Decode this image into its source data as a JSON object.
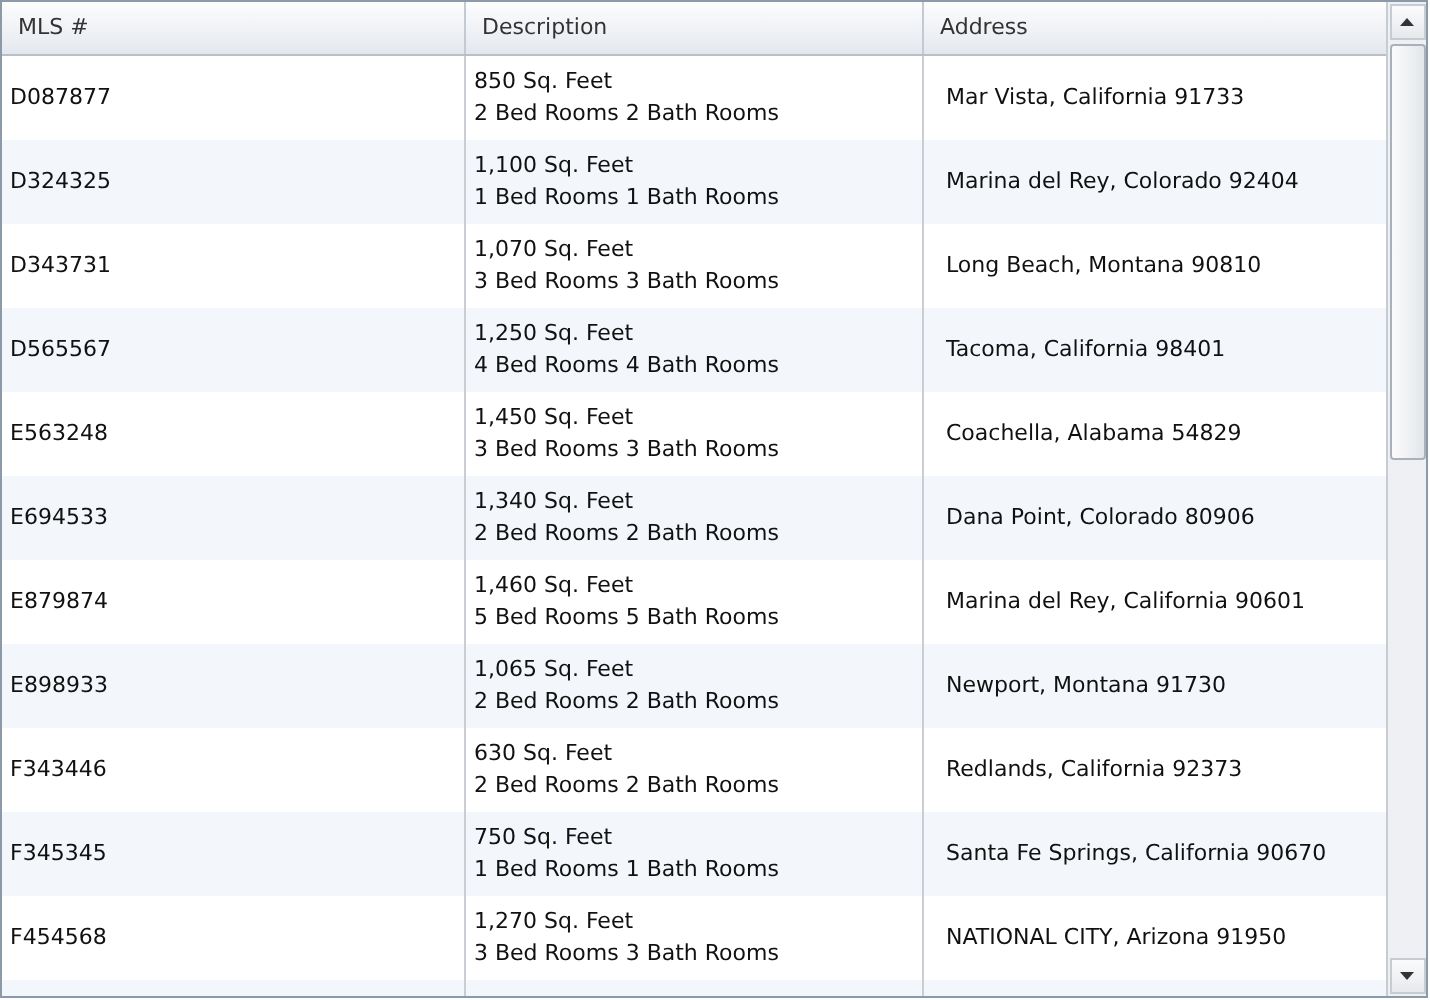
{
  "table": {
    "columns": [
      "MLS #",
      "Description",
      "Address"
    ],
    "rows": [
      {
        "mls": "D087877",
        "area": "850 Sq. Feet",
        "rooms": "2 Bed Rooms 2 Bath Rooms",
        "address": "Mar Vista, California 91733"
      },
      {
        "mls": "D324325",
        "area": "1,100 Sq. Feet",
        "rooms": "1 Bed Rooms 1 Bath Rooms",
        "address": "Marina del Rey, Colorado 92404"
      },
      {
        "mls": "D343731",
        "area": "1,070 Sq. Feet",
        "rooms": "3 Bed Rooms 3 Bath Rooms",
        "address": "Long Beach, Montana 90810"
      },
      {
        "mls": "D565567",
        "area": "1,250 Sq. Feet",
        "rooms": "4 Bed Rooms 4 Bath Rooms",
        "address": "Tacoma, California 98401"
      },
      {
        "mls": "E563248",
        "area": "1,450 Sq. Feet",
        "rooms": "3 Bed Rooms 3 Bath Rooms",
        "address": "Coachella, Alabama 54829"
      },
      {
        "mls": "E694533",
        "area": "1,340 Sq. Feet",
        "rooms": "2 Bed Rooms 2 Bath Rooms",
        "address": "Dana Point, Colorado 80906"
      },
      {
        "mls": "E879874",
        "area": "1,460 Sq. Feet",
        "rooms": "5 Bed Rooms 5 Bath Rooms",
        "address": "Marina del Rey, California 90601"
      },
      {
        "mls": "E898933",
        "area": "1,065 Sq. Feet",
        "rooms": "2 Bed Rooms 2 Bath Rooms",
        "address": "Newport, Montana 91730"
      },
      {
        "mls": "F343446",
        "area": "630 Sq. Feet",
        "rooms": "2 Bed Rooms 2 Bath Rooms",
        "address": "Redlands, California 92373"
      },
      {
        "mls": "F345345",
        "area": "750 Sq. Feet",
        "rooms": "1 Bed Rooms 1 Bath Rooms",
        "address": "Santa Fe Springs, California 90670"
      },
      {
        "mls": "F454568",
        "area": "1,270 Sq. Feet",
        "rooms": "3 Bed Rooms 3 Bath Rooms",
        "address": "NATIONAL CITY, Arizona 91950"
      }
    ]
  }
}
